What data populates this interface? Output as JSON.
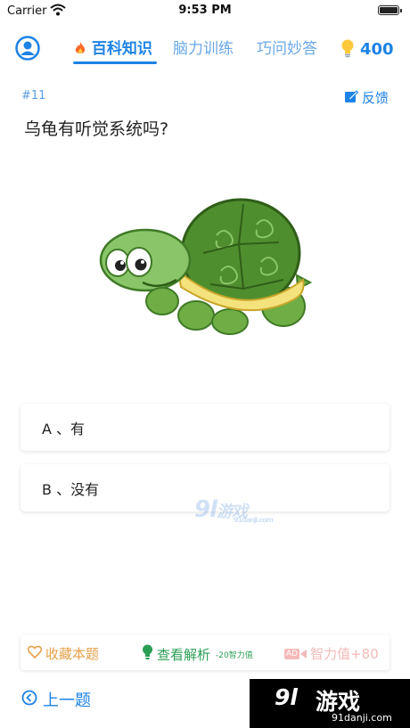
{
  "status": {
    "carrier": "Carrier",
    "time": "9:53 PM"
  },
  "nav": {
    "tabs": [
      {
        "label": "百科知识",
        "active": true
      },
      {
        "label": "脑力训练",
        "active": false
      },
      {
        "label": "巧问妙答",
        "active": false
      }
    ],
    "score": "400"
  },
  "question": {
    "number": "#11",
    "feedback_label": "反馈",
    "text": "乌龟有听觉系统吗?"
  },
  "options": [
    {
      "label": "A 、有"
    },
    {
      "label": "B 、没有"
    }
  ],
  "watermark": {
    "logo": "9l",
    "name": "游戏",
    "url": "91danji.com"
  },
  "actions": {
    "favorite": "收藏本题",
    "view_analysis": "查看解析",
    "view_cost": "-20智力值",
    "ad_badge": "AD",
    "reward": "智力值+80"
  },
  "footer": {
    "prev_label": "上一题"
  },
  "brand": {
    "logo": "9l",
    "name": "游戏",
    "url": "91danji.com"
  },
  "colors": {
    "accent": "#1d83e5",
    "favorite": "#e6a04a",
    "analysis": "#2a9e55",
    "reward": "#f4b9b9"
  }
}
